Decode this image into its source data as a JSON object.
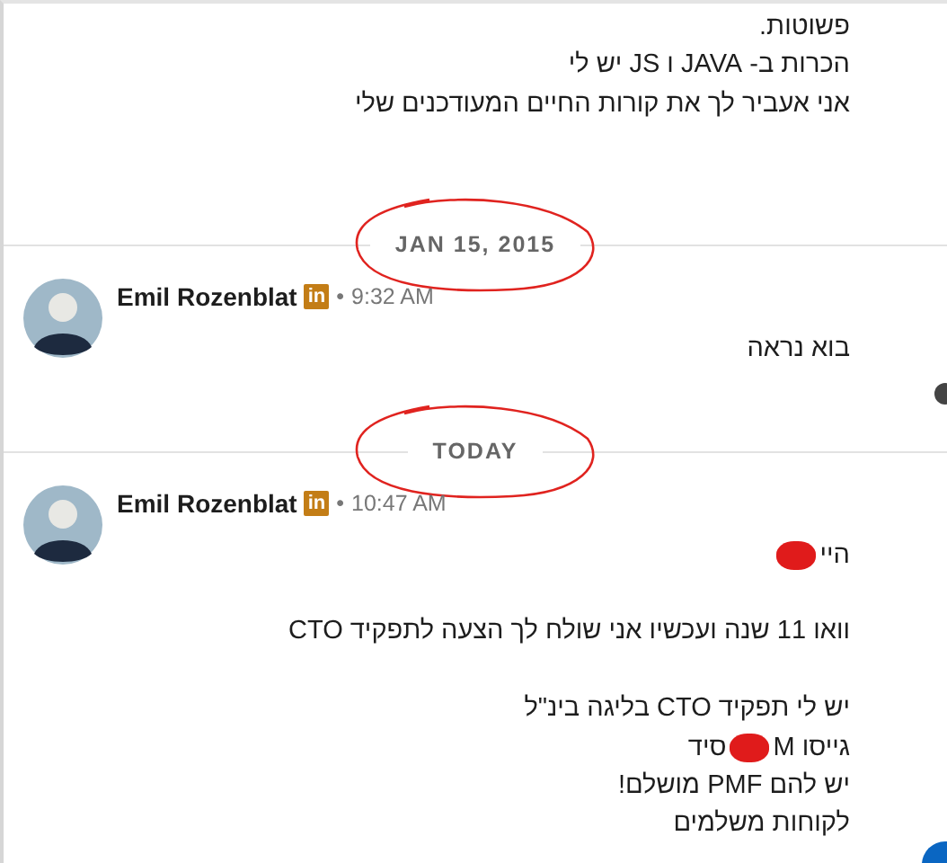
{
  "intro": {
    "paragraphs": [
      [
        [
          {
            "kind": "text",
            "text": "פשוטות."
          }
        ],
        [
          {
            "kind": "text",
            "text": "הכרות ב- JAVA ו JS יש לי"
          }
        ],
        [
          {
            "kind": "text",
            "text": "אני אעביר לך את קורות החיים המעודכנים שלי"
          }
        ]
      ]
    ]
  },
  "sections": [
    {
      "date": "JAN 15, 2015",
      "circled": true,
      "messages": [
        {
          "sender": "Emil Rozenblat",
          "badge": "in",
          "dot": "•",
          "time": "9:32 AM",
          "read_receipt": true,
          "paragraphs": [
            [
              [
                {
                  "kind": "text",
                  "text": "בוא נראה"
                }
              ]
            ]
          ]
        }
      ]
    },
    {
      "date": "TODAY",
      "circled": true,
      "messages": [
        {
          "sender": "Emil Rozenblat",
          "badge": "in",
          "dot": "•",
          "time": "10:47 AM",
          "paragraphs": [
            [
              [
                {
                  "kind": "text",
                  "text": "היי"
                },
                {
                  "kind": "redaction"
                }
              ]
            ],
            [
              [
                {
                  "kind": "text",
                  "text": "וואו 11 שנה ועכשיו אני שולח לך הצעה לתפקיד CTO"
                }
              ]
            ],
            [
              [
                {
                  "kind": "text",
                  "text": "יש לי תפקיד CTO בליגה בינ\"ל"
                }
              ],
              [
                {
                  "kind": "text",
                  "text": "גייסו M"
                },
                {
                  "kind": "redaction"
                },
                {
                  "kind": "text",
                  "text": "סיד"
                }
              ],
              [
                {
                  "kind": "text",
                  "text": "יש להם PMF מושלם!"
                }
              ],
              [
                {
                  "kind": "text",
                  "text": "לקוחות משלמים"
                }
              ]
            ]
          ]
        }
      ]
    }
  ]
}
